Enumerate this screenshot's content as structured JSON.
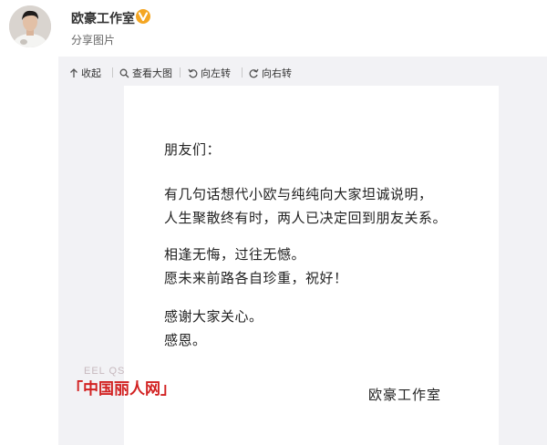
{
  "user": {
    "name": "欧豪工作室",
    "action": "分享图片"
  },
  "toolbar": {
    "collapse_label": "收起",
    "view_large_label": "查看大图",
    "rotate_left_label": "向左转",
    "rotate_right_label": "向右转"
  },
  "letter": {
    "greeting": "朋友们：",
    "lines": [
      "有几句话想代小欧与纯纯向大家坦诚说明，",
      "人生聚散终有时，两人已决定回到朋友关系。",
      "相逢无悔，过往无憾。",
      "愿未来前路各自珍重，祝好！",
      "感谢大家关心。",
      "感恩。"
    ],
    "signature": "欧豪工作室"
  },
  "watermark": {
    "text": "「中国丽人网」",
    "faint_text": "EEL QS"
  },
  "icons": {
    "verified": "verified-v-icon",
    "collapse": "arrow-up-icon",
    "view_large": "magnifier-icon",
    "rotate_left": "rotate-left-icon",
    "rotate_right": "rotate-right-icon"
  },
  "colors": {
    "verified_badge": "#f4a623",
    "watermark": "#d22222",
    "card_background": "#f2f2f5"
  }
}
